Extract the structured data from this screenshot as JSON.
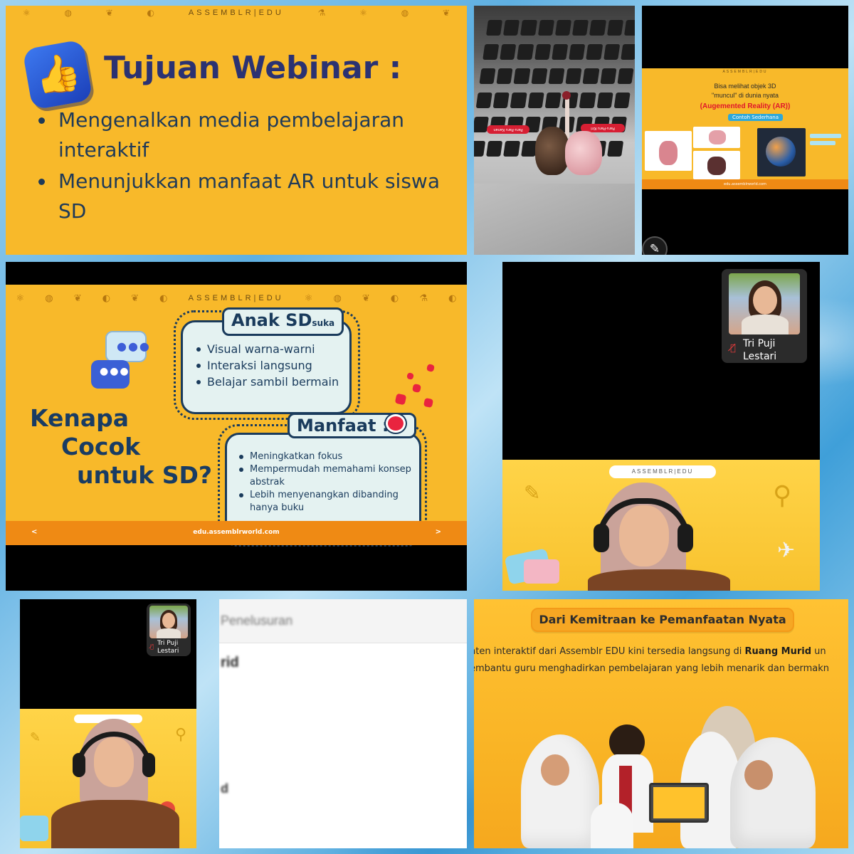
{
  "panel1": {
    "brand": "ASSEMBLR|EDU",
    "title": "Tujuan Webinar :",
    "bullets": [
      "Mengenalkan media pembelajaran interaktif",
      "Menunjukkan manfaat AR untuk siswa SD"
    ],
    "icon": "thumbs-up-icon"
  },
  "panel2": {
    "tag_left": "Paru-Paru Kanan",
    "tag_right": "Paru-Paru Kiri"
  },
  "panel3": {
    "brand": "ASSEMBLR|EDU",
    "line1": "Bisa melihat objek 3D",
    "line2": "\"muncul\" di dunia nyata",
    "ar_label": "(Augemented Reality (AR))",
    "example_tag": "Contoh Sederhana",
    "footer_url": "edu.assemblrworld.com",
    "icon": "pencil-icon"
  },
  "panel4": {
    "brand": "ASSEMBLR|EDU",
    "heading_lines": [
      "Kenapa",
      "Cocok",
      "untuk SD?"
    ],
    "box1_label": "Anak SD",
    "box1_label_small": "suka",
    "box1_items": [
      "Visual warna-warni",
      "Interaksi langsung",
      "Belajar sambil bermain"
    ],
    "box2_label": "Manfaat :",
    "box2_items": [
      "Meningkatkan fokus",
      "Mempermudah memahami konsep abstrak",
      "Lebih menyenangkan dibanding hanya buku"
    ],
    "footer_url": "edu.assemblrworld.com",
    "nav_prev": "<",
    "nav_next": ">"
  },
  "panel5": {
    "participant_name": "Tri Puji Lestari",
    "cam_brand": "ASSEMBLR|EDU",
    "mic_icon": "mic-off-icon"
  },
  "panel6": {
    "participant_name": "Tri Puji Lestari"
  },
  "panel7": {
    "line1": "Penelusuran",
    "line2": "rid",
    "line3": "d"
  },
  "panel8": {
    "title": "Dari Kemitraan ke Pemanfaatan Nyata",
    "line1_pre": "nten interaktif dari Assemblr EDU kini tersedia langsung di ",
    "line1_bold": "Ruang Murid",
    "line1_post": " un",
    "line2": "embantu guru menghadirkan pembelajaran yang lebih menarik dan bermakn"
  },
  "colors": {
    "slide_yellow": "#f8b92a",
    "slide_orange_bar": "#ef8a14",
    "title_navy": "#2b3272",
    "ar_red": "#e0152b"
  }
}
